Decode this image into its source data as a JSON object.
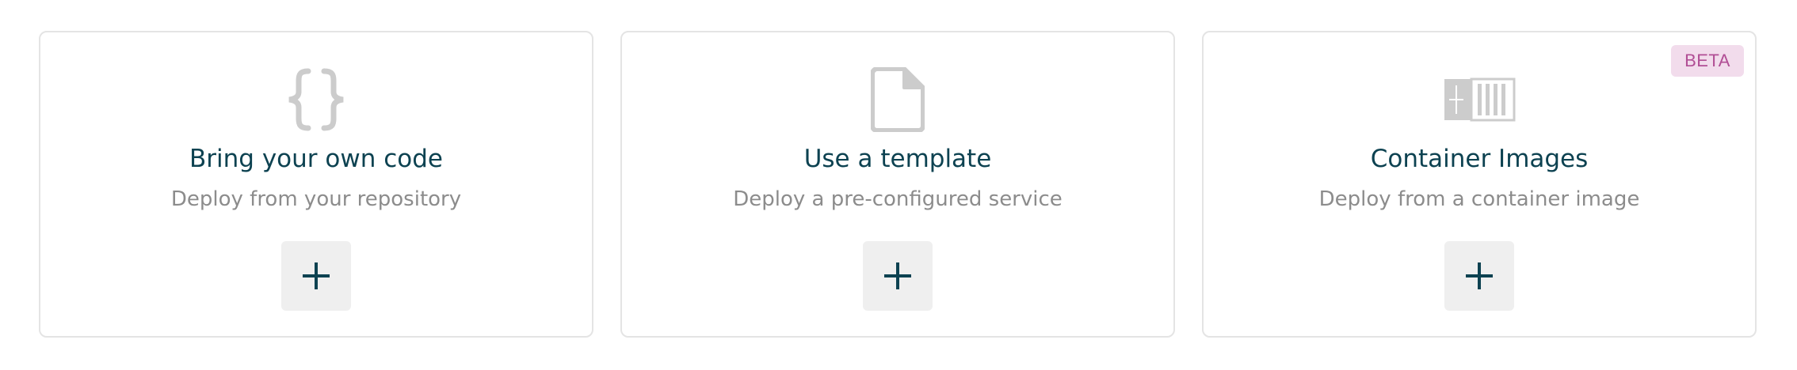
{
  "cards": [
    {
      "title": "Bring your own code",
      "description": "Deploy from your repository",
      "icon": "code-braces-icon",
      "add_button_icon": "plus-icon"
    },
    {
      "title": "Use a template",
      "description": "Deploy a pre-configured service",
      "icon": "document-icon",
      "add_button_icon": "plus-icon"
    },
    {
      "title": "Container Images",
      "description": "Deploy from a container image",
      "icon": "container-icon",
      "add_button_icon": "plus-icon",
      "badge": "BETA"
    }
  ],
  "colors": {
    "title": "#0d4251",
    "description": "#8c8c8c",
    "icon": "#cccccc",
    "button_bg": "#efefef",
    "plus": "#0d4251",
    "badge_bg": "#f2dcec",
    "badge_text": "#b14e95",
    "card_border": "#e4e4e4"
  }
}
